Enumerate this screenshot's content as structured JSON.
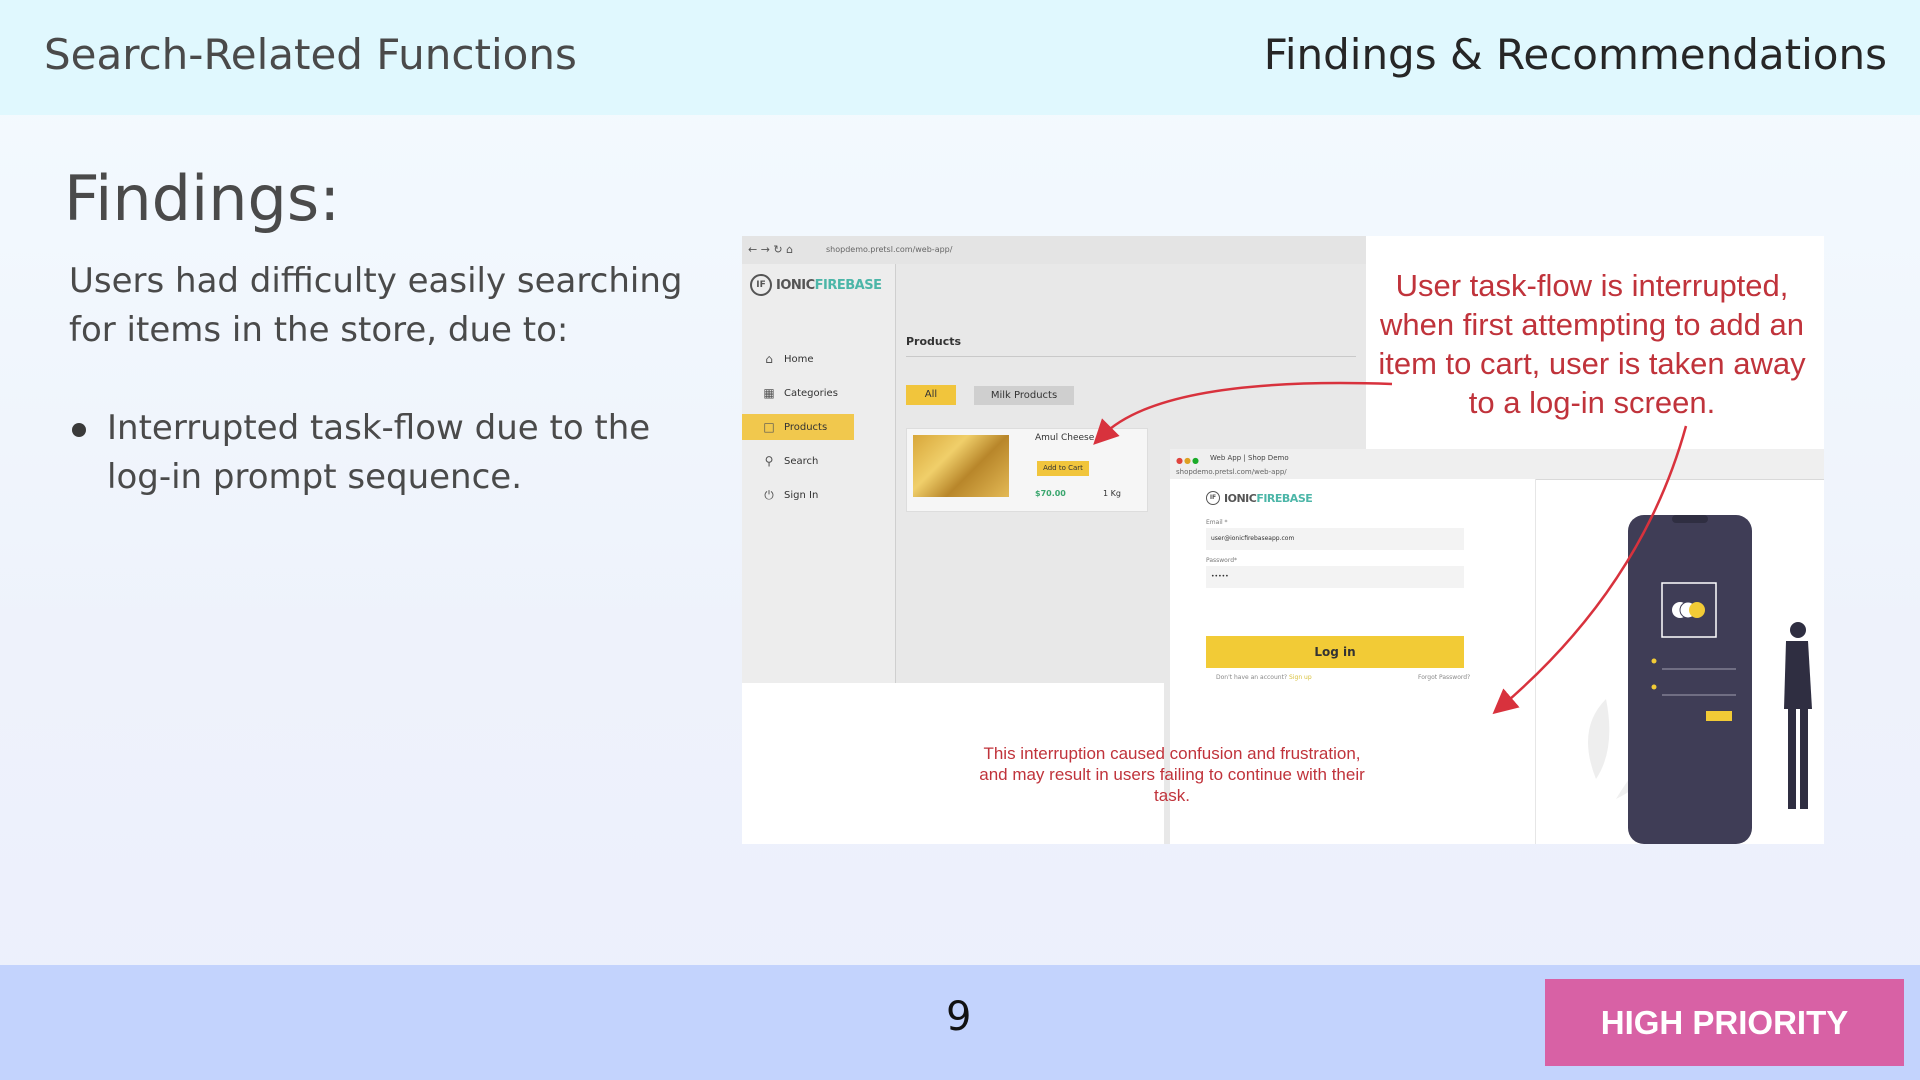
{
  "header": {
    "left_title": "Search-Related Functions",
    "right_title": "Findings & Recommendations"
  },
  "main": {
    "heading": "Findings:",
    "intro": "Users had difficulty easily searching for items in the store, due to:",
    "bullets": [
      "Interrupted task-flow due to the log-in prompt sequence."
    ]
  },
  "screenshot": {
    "browser1": {
      "url": "shopdemo.pretsl.com/web-app/",
      "logo_left": "IONIC",
      "logo_right": "FIREBASE",
      "logo_badge": "IF",
      "sidebar": [
        {
          "label": "Home",
          "icon": "home-icon"
        },
        {
          "label": "Categories",
          "icon": "grid-icon"
        },
        {
          "label": "Products",
          "icon": "store-icon"
        },
        {
          "label": "Search",
          "icon": "search-icon"
        },
        {
          "label": "Sign In",
          "icon": "power-icon"
        }
      ],
      "products_title": "Products",
      "filters": [
        "All",
        "Milk Products"
      ],
      "product": {
        "name": "Amul Cheese",
        "button": "Add to Cart",
        "price": "$70.00",
        "unit": "1 Kg"
      }
    },
    "browser2": {
      "tab_title": "Web App | Shop Demo",
      "url": "shopdemo.pretsl.com/web-app/",
      "email_label": "Email *",
      "email_value": "user@ionicfirebaseapp.com",
      "password_label": "Password*",
      "password_value": "•••••",
      "login_button": "Log in",
      "no_account": "Don't have an account?",
      "signup": "Sign up",
      "forgot": "Forgot Password?"
    },
    "callout_top": "User task-flow is interrupted, when first attempting to add an item to cart, user is taken away to a log-in screen.",
    "callout_bottom": "This interruption caused confusion and frustration, and may result in users failing to continue with their task.",
    "accent_color": "#c0333b"
  },
  "footer": {
    "page_number": "9",
    "priority_badge": "HIGH PRIORITY",
    "priority_color": "#d861a5"
  }
}
